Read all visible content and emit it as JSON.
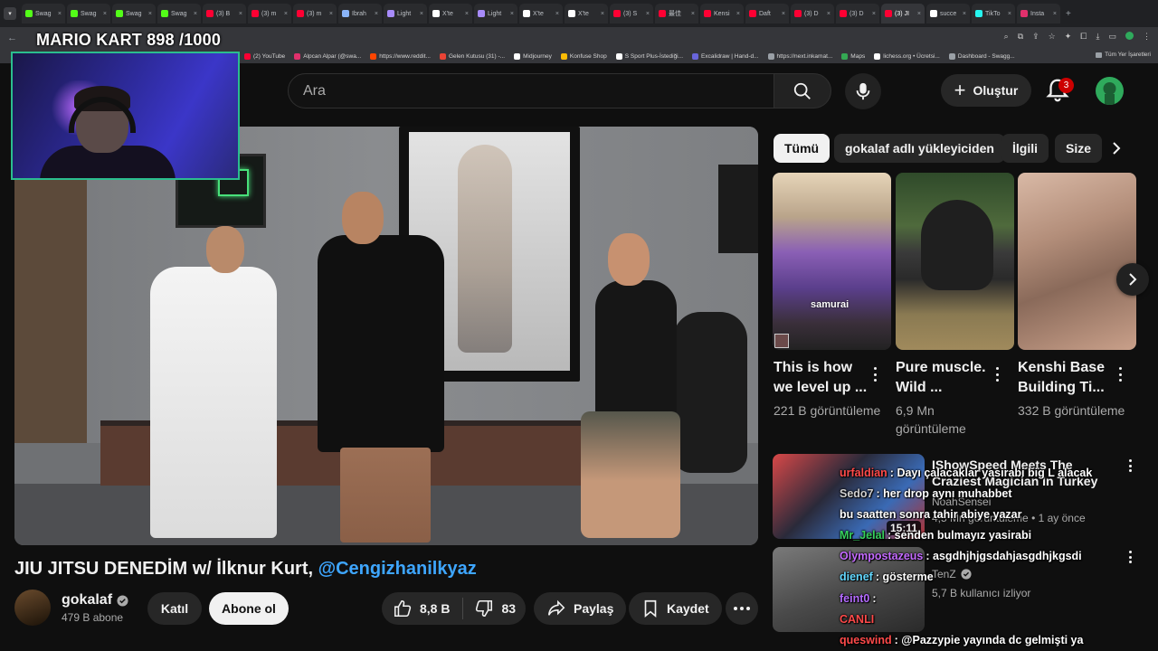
{
  "browser": {
    "tabs": [
      {
        "label": "Swag",
        "color": "#53fc18"
      },
      {
        "label": "Swag",
        "color": "#53fc18"
      },
      {
        "label": "Swag",
        "color": "#53fc18"
      },
      {
        "label": "Swag",
        "color": "#53fc18"
      },
      {
        "label": "(3) B",
        "color": "#ff0033"
      },
      {
        "label": "(3) m",
        "color": "#ff0033"
      },
      {
        "label": "(3) m",
        "color": "#ff0033"
      },
      {
        "label": "Ibrah",
        "color": "#8ab4f8"
      },
      {
        "label": "Light",
        "color": "#a78bfa"
      },
      {
        "label": "X'te",
        "color": "#ffffff"
      },
      {
        "label": "Light",
        "color": "#a78bfa"
      },
      {
        "label": "X'te",
        "color": "#ffffff"
      },
      {
        "label": "X'te",
        "color": "#ffffff"
      },
      {
        "label": "(3) S",
        "color": "#ff0033"
      },
      {
        "label": "最佳",
        "color": "#ff0033"
      },
      {
        "label": "Kensi",
        "color": "#ff0033"
      },
      {
        "label": "Daft",
        "color": "#ff0033"
      },
      {
        "label": "(3) D",
        "color": "#ff0033"
      },
      {
        "label": "(3) D",
        "color": "#ff0033"
      },
      {
        "label": "(3) JI",
        "color": "#ff0033"
      },
      {
        "label": "succe",
        "color": "#ffffff"
      },
      {
        "label": "TikTo",
        "color": "#25f4ee"
      },
      {
        "label": "Insta",
        "color": "#e1306c"
      }
    ],
    "bookmarks": [
      {
        "label": "(2) YouTube",
        "color": "#ff0033"
      },
      {
        "label": "Alpcan Alpar (@swa...",
        "color": "#e1306c"
      },
      {
        "label": "https://www.reddit...",
        "color": "#ff4500"
      },
      {
        "label": "Gelen Kutusu (31) -...",
        "color": "#ea4335"
      },
      {
        "label": "Midjourney",
        "color": "#ffffff"
      },
      {
        "label": "Konfuse Shop",
        "color": "#fbbc05"
      },
      {
        "label": "S Sport Plus-İstediği...",
        "color": "#ffffff"
      },
      {
        "label": "Excalidraw | Hand-d...",
        "color": "#6965db"
      },
      {
        "label": "https://next.inkamat...",
        "color": "#9aa0a6"
      },
      {
        "label": "Maps",
        "color": "#34a853"
      },
      {
        "label": "lichess.org • Ücretsi...",
        "color": "#ffffff"
      },
      {
        "label": "Dashboard - Swagg...",
        "color": "#9aa0a6"
      }
    ],
    "all_bookmarks": "Tüm Yer İşaretleri"
  },
  "overlay": {
    "title": "MARIO KART  898 /1000"
  },
  "header": {
    "search_placeholder": "Ara",
    "create_label": "Oluştur",
    "notification_count": "3"
  },
  "video": {
    "title": "JIU JITSU DENEDİM w/ İlknur Kurt,",
    "mention": "@Cengizhanilkyaz",
    "channel_name": "gokalaf",
    "subscribers": "479 B abone",
    "join_label": "Katıl",
    "subscribe_label": "Abone ol",
    "likes": "8,8 B",
    "dislikes": "83",
    "share_label": "Paylaş",
    "save_label": "Kaydet"
  },
  "chips": [
    "Tümü",
    "gokalaf adlı yükleyiciden",
    "İlgili",
    "Size"
  ],
  "shorts": [
    {
      "title": "This is how we level up ...",
      "views": "221 B görüntüleme",
      "overlay_text": "samurai"
    },
    {
      "title": "Pure muscle. Wild ...",
      "views": "6,9 Mn görüntüleme"
    },
    {
      "title": "Kenshi Base Building Ti...",
      "views": "332 B görüntüleme"
    }
  ],
  "recommended": [
    {
      "title": "IShowSpeed Meets The Craziest Magician In Turkey",
      "channel": "NoahSensei",
      "meta": "4,5 Mn görüntüleme • 1 ay önce",
      "duration": "15:11"
    },
    {
      "title": "",
      "channel": "TenZ",
      "meta": "5,7 B kullanıcı izliyor"
    }
  ],
  "chat": [
    {
      "user": "urfaldian",
      "text": "Dayı çalacaklar yasirabi big L alacak",
      "color": "#ff4a4a"
    },
    {
      "user": "Sedo7",
      "text": "her drop aynı muhabbet",
      "color": "#cfcfcf"
    },
    {
      "user": "",
      "text": "bu saatten sonra tahir abiye yazar",
      "color": "#ff4a4a"
    },
    {
      "user": "Mr_Jelal",
      "text": "senden bulmayız yasirabi",
      "color": "#36d05d"
    },
    {
      "user": "Olympostazeus",
      "text": "asgdhjhjgsdahjasgdhjkgsdi",
      "color": "#c46bff"
    },
    {
      "user": "dienef",
      "text": "gösterme",
      "color": "#63d8ff"
    },
    {
      "user": "feint0",
      "text": "",
      "color": "#b46bff"
    },
    {
      "user": "",
      "text": "CANLI",
      "color": "#ff4a4a"
    },
    {
      "user": "queswind",
      "text": "@Pazzypie yayında dc gelmişti ya",
      "color": "#ff4a4a"
    }
  ]
}
